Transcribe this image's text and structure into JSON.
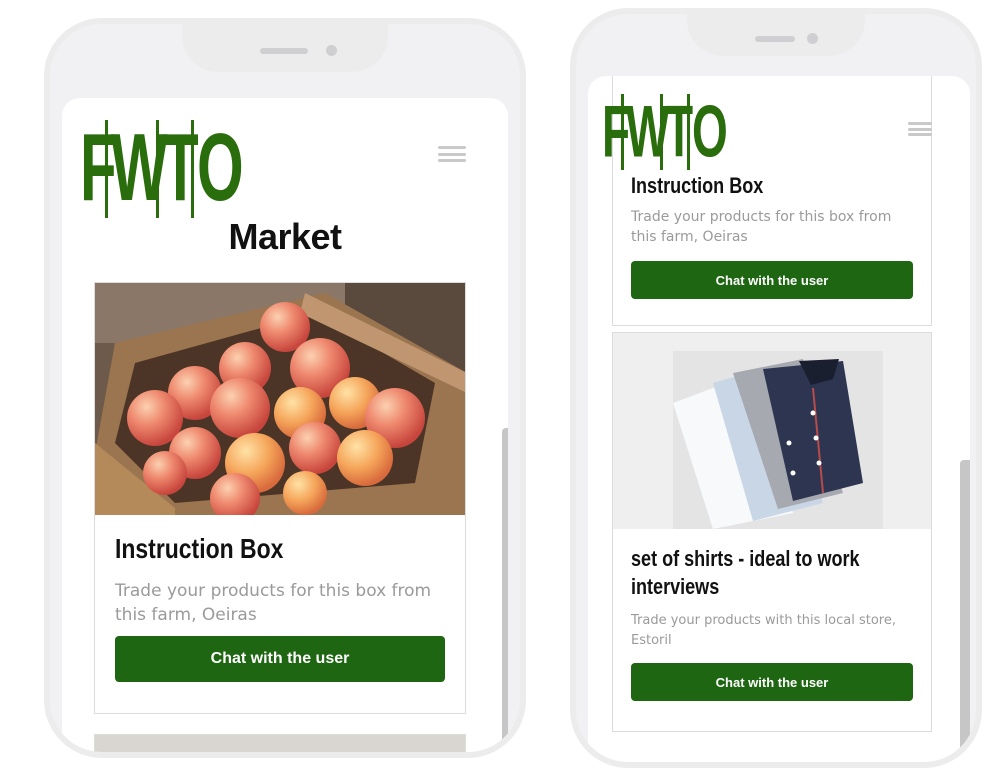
{
  "brand": {
    "logo_letters": [
      "F",
      "W",
      "T",
      "O"
    ],
    "color": "#2a6d0c"
  },
  "left_screen": {
    "page_title": "Market",
    "card": {
      "title": "Instruction Box",
      "description": "Trade your products for this box from this farm, Oeiras",
      "button": "Chat with the user",
      "image_icon": "crate-of-peaches"
    }
  },
  "right_screen": {
    "card_top": {
      "title": "Instruction Box",
      "description": "Trade your products for this box from this farm, Oeiras",
      "button": "Chat with the user"
    },
    "card_bottom": {
      "title": "set of shirts - ideal to work interviews",
      "description": "Trade your products with this local store, Estoril",
      "button": "Chat with the user",
      "image_icon": "folded-shirts"
    }
  },
  "colors": {
    "button": "#1e6612",
    "scrollbar": "#c6c6c6"
  }
}
